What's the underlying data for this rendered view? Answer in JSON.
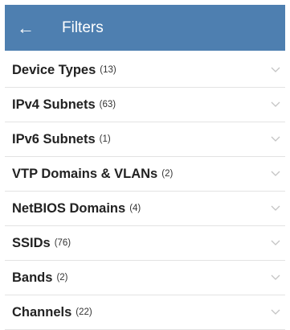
{
  "header": {
    "back_icon": "←",
    "title": "Filters",
    "color": "#4e7fb0"
  },
  "filters": [
    {
      "label": "Device Types",
      "count": "(13)"
    },
    {
      "label": "IPv4 Subnets",
      "count": "(63)"
    },
    {
      "label": "IPv6 Subnets",
      "count": "(1)"
    },
    {
      "label": "VTP Domains & VLANs",
      "count": "(2)"
    },
    {
      "label": "NetBIOS Domains",
      "count": "(4)"
    },
    {
      "label": "SSIDs",
      "count": "(76)"
    },
    {
      "label": "Bands",
      "count": "(2)"
    },
    {
      "label": "Channels",
      "count": "(22)"
    }
  ],
  "icons": {
    "expand": "chevron-down-icon"
  }
}
